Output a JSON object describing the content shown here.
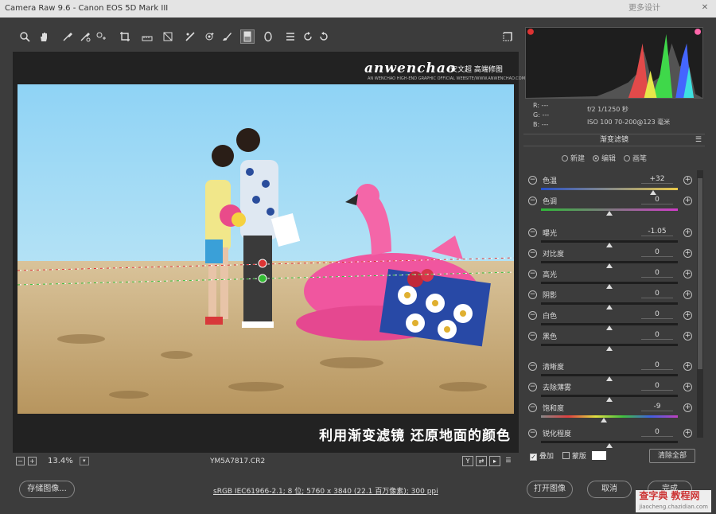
{
  "window": {
    "title": "Camera Raw 9.6 - Canon EOS 5D Mark III",
    "right_title": "更多设计"
  },
  "toolbar": {
    "tools": [
      "zoom-icon",
      "hand-icon",
      "white-balance-icon",
      "color-sampler-icon",
      "target-adjust-icon",
      "crop-icon",
      "straighten-icon",
      "transform-icon",
      "spot-removal-icon",
      "redeye-icon",
      "brush-icon",
      "graduated-filter-icon",
      "radial-filter-icon",
      "list-icon",
      "rotate-ccw-icon",
      "rotate-cw-icon"
    ],
    "fullscreen_icon": "fullscreen-icon"
  },
  "brand": {
    "logo": "anwenchao",
    "cn": "安文超 高端修图",
    "sub": "AN WENCHAO HIGH-END GRAPHIC OFFICIAL WEBSITE/WWW.ANWENCHAO.COM"
  },
  "caption": "利用渐变滤镜 还原地面的颜色",
  "status": {
    "zoom": "13.4%",
    "filename": "YM5A7817.CR2",
    "view_buttons": [
      "Y",
      "",
      ""
    ]
  },
  "footer": {
    "save": "存储图像...",
    "workflow": "sRGB IEC61966-2.1; 8 位; 5760 x 3840 (22.1 百万像素); 300 ppi",
    "open": "打开图像",
    "cancel": "取消",
    "done": "完成"
  },
  "exif": {
    "r": "R: ---",
    "g": "G: ---",
    "b": "B: ---",
    "aperture": "f/2   1/1250 秒",
    "iso": "ISO 100   70-200@123 毫米"
  },
  "panel": {
    "title": "渐变滤镜",
    "modes": [
      "新建",
      "编辑",
      "画笔"
    ],
    "selected_mode": 1
  },
  "sliders": [
    {
      "label": "色温",
      "value": "+32",
      "level": 0.82,
      "track": "temp"
    },
    {
      "label": "色调",
      "value": "0",
      "level": 0.5,
      "track": "tint"
    },
    {
      "label": "曝光",
      "value": "-1.05",
      "level": 0.5,
      "track": "gray"
    },
    {
      "label": "对比度",
      "value": "0",
      "level": 0.5,
      "track": "gray"
    },
    {
      "label": "高光",
      "value": "0",
      "level": 0.5,
      "track": "gray"
    },
    {
      "label": "阴影",
      "value": "0",
      "level": 0.5,
      "track": "gray"
    },
    {
      "label": "白色",
      "value": "0",
      "level": 0.5,
      "track": "gray"
    },
    {
      "label": "黑色",
      "value": "0",
      "level": 0.5,
      "track": "gray"
    },
    {
      "label": "清晰度",
      "value": "0",
      "level": 0.5,
      "track": "gray"
    },
    {
      "label": "去除薄雾",
      "value": "0",
      "level": 0.5,
      "track": "gray"
    },
    {
      "label": "饱和度",
      "value": "-9",
      "level": 0.46,
      "track": "sat"
    },
    {
      "label": "锐化程度",
      "value": "0",
      "level": 0.5,
      "track": "gray"
    }
  ],
  "options": {
    "overlay": "叠加",
    "mask": "蒙版",
    "clear": "清除全部"
  },
  "watermark": {
    "main": "查字典 教程网",
    "url": "jiaocheng.chazidian.com"
  }
}
